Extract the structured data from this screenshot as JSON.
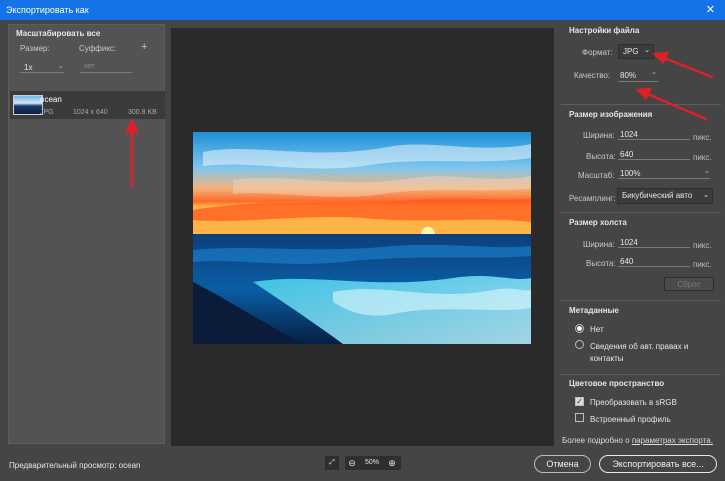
{
  "window": {
    "title": "Экспортировать как",
    "close_glyph": "✕"
  },
  "scale_panel": {
    "header": "Масштабировать все",
    "size_label": "Размер:",
    "suffix_label": "Суффикс:",
    "add_glyph": "+",
    "size_value": "1x",
    "suffix_placeholder": "нет"
  },
  "asset": {
    "name": "ocean",
    "format": "JPG",
    "dimensions": "1024 x 640",
    "size": "300.8 KB"
  },
  "file_settings": {
    "header": "Настройки файла",
    "format_label": "Формат:",
    "format_value": "JPG",
    "quality_label": "Качество:",
    "quality_value": "80%"
  },
  "image_size": {
    "header": "Размер изображения",
    "width_label": "Ширина:",
    "width_value": "1024",
    "height_label": "Высота:",
    "height_value": "640",
    "scale_label": "Масштаб:",
    "scale_value": "100%",
    "resample_label": "Ресамплинг:",
    "resample_value": "Бикубический авто",
    "unit": "пикс."
  },
  "canvas_size": {
    "header": "Размер холста",
    "width_label": "Ширина:",
    "width_value": "1024",
    "height_label": "Высота:",
    "height_value": "640",
    "unit": "пикс.",
    "reset_label": "Сброс"
  },
  "metadata": {
    "header": "Метаданные",
    "option_none": "Нет",
    "option_copyright_line1": "Сведения об авт. правах и",
    "option_copyright_line2": "контакты"
  },
  "color_space": {
    "header": "Цветовое пространство",
    "convert_srgb": "Преобразовать в sRGB",
    "embed_profile": "Встроенный профиль"
  },
  "more_info": {
    "prefix": "Более подробно о ",
    "link": "параметрах экспорта."
  },
  "footer": {
    "preview_label": "Предварительный просмотр: ocean",
    "zoom": "50%",
    "cancel": "Отмена",
    "export": "Экспортировать все..."
  },
  "colors": {
    "accent": "#1473e6",
    "annotation_arrow": "#e11f26"
  }
}
